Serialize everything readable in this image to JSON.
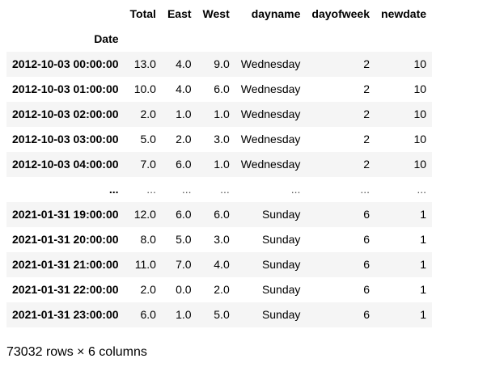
{
  "table": {
    "columns": [
      "",
      "Total",
      "East",
      "West",
      "dayname",
      "dayofweek",
      "newdate"
    ],
    "index_name": "Date",
    "rows": [
      [
        "2012-10-03 00:00:00",
        "13.0",
        "4.0",
        "9.0",
        "Wednesday",
        "2",
        "10"
      ],
      [
        "2012-10-03 01:00:00",
        "10.0",
        "4.0",
        "6.0",
        "Wednesday",
        "2",
        "10"
      ],
      [
        "2012-10-03 02:00:00",
        "2.0",
        "1.0",
        "1.0",
        "Wednesday",
        "2",
        "10"
      ],
      [
        "2012-10-03 03:00:00",
        "5.0",
        "2.0",
        "3.0",
        "Wednesday",
        "2",
        "10"
      ],
      [
        "2012-10-03 04:00:00",
        "7.0",
        "6.0",
        "1.0",
        "Wednesday",
        "2",
        "10"
      ],
      [
        "...",
        "...",
        "...",
        "...",
        "...",
        "...",
        "..."
      ],
      [
        "2021-01-31 19:00:00",
        "12.0",
        "6.0",
        "6.0",
        "Sunday",
        "6",
        "1"
      ],
      [
        "2021-01-31 20:00:00",
        "8.0",
        "5.0",
        "3.0",
        "Sunday",
        "6",
        "1"
      ],
      [
        "2021-01-31 21:00:00",
        "11.0",
        "7.0",
        "4.0",
        "Sunday",
        "6",
        "1"
      ],
      [
        "2021-01-31 22:00:00",
        "2.0",
        "0.0",
        "2.0",
        "Sunday",
        "6",
        "1"
      ],
      [
        "2021-01-31 23:00:00",
        "6.0",
        "1.0",
        "5.0",
        "Sunday",
        "6",
        "1"
      ]
    ]
  },
  "footer": {
    "shape_text": "73032 rows × 6 columns"
  }
}
